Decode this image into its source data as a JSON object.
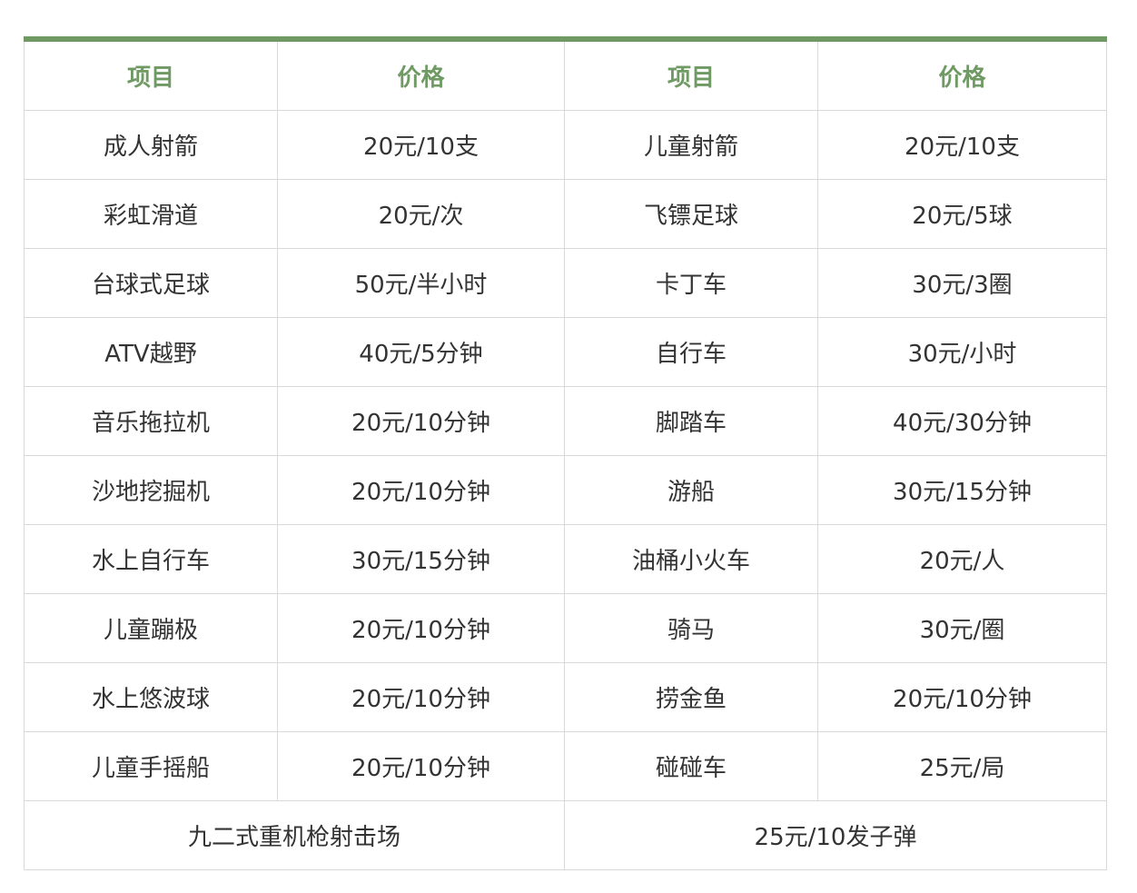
{
  "header": [
    "项目",
    "价格",
    "项目",
    "价格"
  ],
  "rows": [
    [
      "成人射箭",
      "20元/10支",
      "儿童射箭",
      "20元/10支"
    ],
    [
      "彩虹滑道",
      "20元/次",
      "飞镖足球",
      "20元/5球"
    ],
    [
      "台球式足球",
      "50元/半小时",
      "卡丁车",
      "30元/3圈"
    ],
    [
      "ATV越野",
      "40元/5分钟",
      "自行车",
      "30元/小时"
    ],
    [
      "音乐拖拉机",
      "20元/10分钟",
      "脚踏车",
      "40元/30分钟"
    ],
    [
      "沙地挖掘机",
      "20元/10分钟",
      "游船",
      "30元/15分钟"
    ],
    [
      "水上自行车",
      "30元/15分钟",
      "油桶小火车",
      "20元/人"
    ],
    [
      "儿童蹦极",
      "20元/10分钟",
      "骑马",
      "30元/圈"
    ],
    [
      "水上悠波球",
      "20元/10分钟",
      "捞金鱼",
      "20元/10分钟"
    ],
    [
      "儿童手摇船",
      "20元/10分钟",
      "碰碰车",
      "25元/局"
    ]
  ],
  "footer_row": [
    "九二式重机枪射击场",
    "25元/10发子弹"
  ],
  "colors": {
    "accent": "#6f9a64",
    "border": "#d9d9d9",
    "text": "#333333"
  }
}
